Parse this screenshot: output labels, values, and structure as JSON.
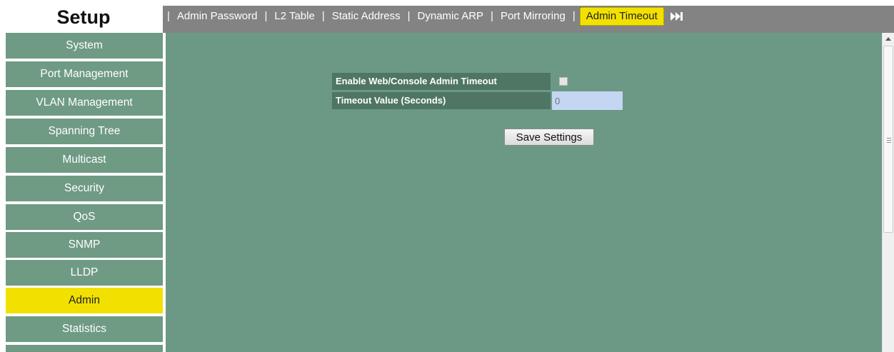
{
  "header": {
    "title": "Setup"
  },
  "tabs": [
    {
      "label": "Admin Password"
    },
    {
      "label": "L2 Table"
    },
    {
      "label": "Static Address"
    },
    {
      "label": "Dynamic ARP"
    },
    {
      "label": "Port Mirroring"
    },
    {
      "label": "Admin Timeout",
      "active": true
    }
  ],
  "tab_separator": "|",
  "tabs_more_icon": "fast-forward-icon",
  "sidebar": {
    "items": [
      {
        "label": "System"
      },
      {
        "label": "Port Management"
      },
      {
        "label": "VLAN Management"
      },
      {
        "label": "Spanning Tree"
      },
      {
        "label": "Multicast"
      },
      {
        "label": "Security"
      },
      {
        "label": "QoS"
      },
      {
        "label": "SNMP"
      },
      {
        "label": "LLDP"
      },
      {
        "label": "Admin",
        "active": true
      },
      {
        "label": "Statistics"
      }
    ]
  },
  "form": {
    "enable_label": "Enable Web/Console Admin Timeout",
    "enable_checked": false,
    "timeout_label": "Timeout Value (Seconds)",
    "timeout_placeholder": "0",
    "save_label": "Save Settings"
  },
  "colors": {
    "content_bg": "#6c9985",
    "sidebar_item_bg": "#6f9a84",
    "label_bg": "#4f7664",
    "active_highlight": "#f2e100",
    "tabbar_bg": "#838383",
    "input_bg": "#c4d6f2"
  }
}
